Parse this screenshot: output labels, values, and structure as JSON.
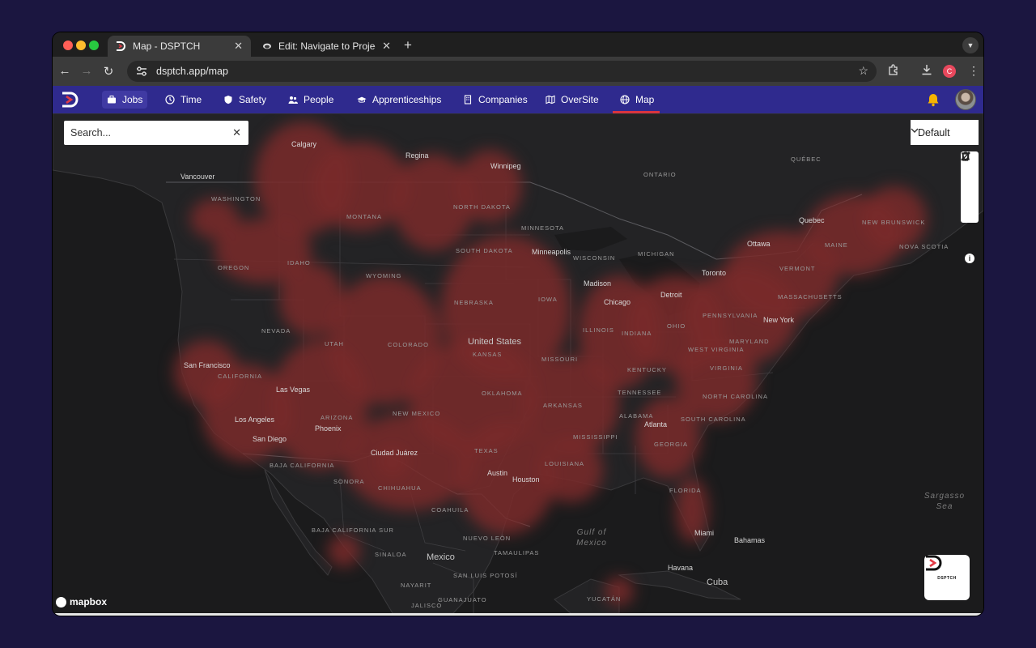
{
  "browser": {
    "tabs": [
      {
        "title": "Map - DSPTCH",
        "active": true
      },
      {
        "title": "Edit: Navigate to Projects GIF",
        "active": false
      }
    ],
    "url": "dsptch.app/map",
    "profile_initial": "C"
  },
  "app": {
    "nav": [
      {
        "label": "Jobs",
        "icon": "briefcase-icon"
      },
      {
        "label": "Time",
        "icon": "clock-icon"
      },
      {
        "label": "Safety",
        "icon": "shield-icon"
      },
      {
        "label": "People",
        "icon": "people-icon"
      },
      {
        "label": "Apprenticeships",
        "icon": "graduation-cap-icon"
      },
      {
        "label": "Companies",
        "icon": "building-icon"
      },
      {
        "label": "OverSite",
        "icon": "folded-map-icon"
      },
      {
        "label": "Map",
        "icon": "globe-icon"
      }
    ],
    "active_nav": "Map",
    "colors": {
      "nav_bg": "#2f2a8e",
      "active_underline": "#d8343f",
      "heat": "#7a2a2a",
      "map_bg": "#1b1b1c"
    }
  },
  "map": {
    "search_placeholder": "Search...",
    "style_selected": "Default",
    "attribution": "mapbox",
    "badge_text": "DSPTCH",
    "regions": [
      "Washington",
      "Oregon",
      "Idaho",
      "Montana",
      "Wyoming",
      "Nevada",
      "Utah",
      "Colorado",
      "California",
      "Arizona",
      "New Mexico",
      "North Dakota",
      "South Dakota",
      "Nebraska",
      "Kansas",
      "Oklahoma",
      "Texas",
      "Minnesota",
      "Iowa",
      "Missouri",
      "Arkansas",
      "Louisiana",
      "Mississippi",
      "Alabama",
      "Georgia",
      "Florida",
      "Tennessee",
      "Kentucky",
      "Illinois",
      "Indiana",
      "Ohio",
      "Michigan",
      "Wisconsin",
      "Pennsylvania",
      "West Virginia",
      "Virginia",
      "North Carolina",
      "South Carolina",
      "Maryland",
      "Vermont",
      "Massachusetts",
      "Maine",
      "New Brunswick",
      "Nova Scotia",
      "Ontario",
      "Québec",
      "Sonora",
      "Chihuahua",
      "Coahuila",
      "Nuevo León",
      "Tamaulipas",
      "Sinaloa",
      "Baja California",
      "Baja California Sur",
      "Nayarit",
      "Jalisco",
      "Guanajuato",
      "San Luis Potosí",
      "Yucatán"
    ],
    "cities": [
      "Vancouver",
      "Calgary",
      "Regina",
      "Winnipeg",
      "Minneapolis",
      "Madison",
      "Chicago",
      "Detroit",
      "Toronto",
      "Ottawa",
      "Quebec",
      "New York",
      "San Francisco",
      "Las Vegas",
      "Los Angeles",
      "San Diego",
      "Phoenix",
      "Ciudad Juárez",
      "Austin",
      "Houston",
      "Atlanta",
      "Miami",
      "Bahamas",
      "Havana",
      "Cuba",
      "Mexico"
    ],
    "country": "United States",
    "waters": [
      "Gulf of Mexico",
      "Sargasso Sea"
    ]
  }
}
